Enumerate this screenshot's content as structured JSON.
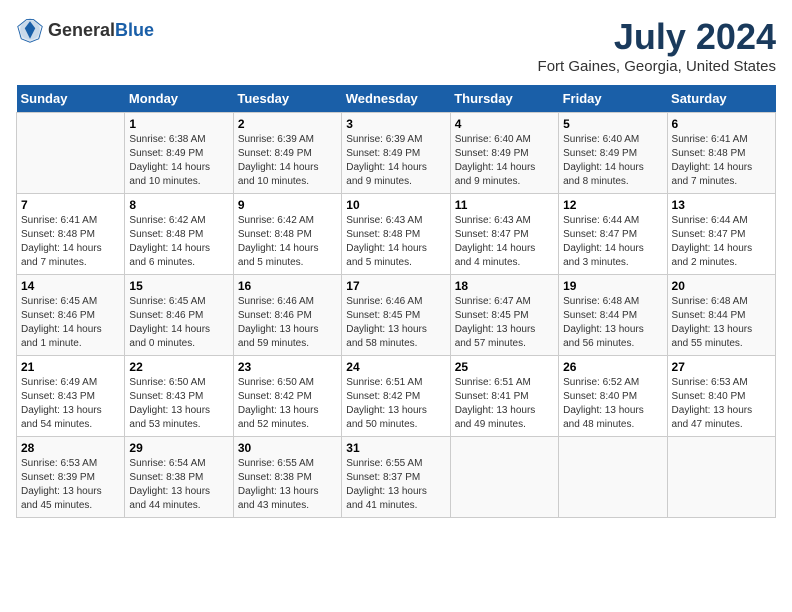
{
  "header": {
    "logo_general": "General",
    "logo_blue": "Blue",
    "title": "July 2024",
    "subtitle": "Fort Gaines, Georgia, United States"
  },
  "calendar": {
    "days_of_week": [
      "Sunday",
      "Monday",
      "Tuesday",
      "Wednesday",
      "Thursday",
      "Friday",
      "Saturday"
    ],
    "weeks": [
      [
        {
          "day": "",
          "info": ""
        },
        {
          "day": "1",
          "info": "Sunrise: 6:38 AM\nSunset: 8:49 PM\nDaylight: 14 hours\nand 10 minutes."
        },
        {
          "day": "2",
          "info": "Sunrise: 6:39 AM\nSunset: 8:49 PM\nDaylight: 14 hours\nand 10 minutes."
        },
        {
          "day": "3",
          "info": "Sunrise: 6:39 AM\nSunset: 8:49 PM\nDaylight: 14 hours\nand 9 minutes."
        },
        {
          "day": "4",
          "info": "Sunrise: 6:40 AM\nSunset: 8:49 PM\nDaylight: 14 hours\nand 9 minutes."
        },
        {
          "day": "5",
          "info": "Sunrise: 6:40 AM\nSunset: 8:49 PM\nDaylight: 14 hours\nand 8 minutes."
        },
        {
          "day": "6",
          "info": "Sunrise: 6:41 AM\nSunset: 8:48 PM\nDaylight: 14 hours\nand 7 minutes."
        }
      ],
      [
        {
          "day": "7",
          "info": "Sunrise: 6:41 AM\nSunset: 8:48 PM\nDaylight: 14 hours\nand 7 minutes."
        },
        {
          "day": "8",
          "info": "Sunrise: 6:42 AM\nSunset: 8:48 PM\nDaylight: 14 hours\nand 6 minutes."
        },
        {
          "day": "9",
          "info": "Sunrise: 6:42 AM\nSunset: 8:48 PM\nDaylight: 14 hours\nand 5 minutes."
        },
        {
          "day": "10",
          "info": "Sunrise: 6:43 AM\nSunset: 8:48 PM\nDaylight: 14 hours\nand 5 minutes."
        },
        {
          "day": "11",
          "info": "Sunrise: 6:43 AM\nSunset: 8:47 PM\nDaylight: 14 hours\nand 4 minutes."
        },
        {
          "day": "12",
          "info": "Sunrise: 6:44 AM\nSunset: 8:47 PM\nDaylight: 14 hours\nand 3 minutes."
        },
        {
          "day": "13",
          "info": "Sunrise: 6:44 AM\nSunset: 8:47 PM\nDaylight: 14 hours\nand 2 minutes."
        }
      ],
      [
        {
          "day": "14",
          "info": "Sunrise: 6:45 AM\nSunset: 8:46 PM\nDaylight: 14 hours\nand 1 minute."
        },
        {
          "day": "15",
          "info": "Sunrise: 6:45 AM\nSunset: 8:46 PM\nDaylight: 14 hours\nand 0 minutes."
        },
        {
          "day": "16",
          "info": "Sunrise: 6:46 AM\nSunset: 8:46 PM\nDaylight: 13 hours\nand 59 minutes."
        },
        {
          "day": "17",
          "info": "Sunrise: 6:46 AM\nSunset: 8:45 PM\nDaylight: 13 hours\nand 58 minutes."
        },
        {
          "day": "18",
          "info": "Sunrise: 6:47 AM\nSunset: 8:45 PM\nDaylight: 13 hours\nand 57 minutes."
        },
        {
          "day": "19",
          "info": "Sunrise: 6:48 AM\nSunset: 8:44 PM\nDaylight: 13 hours\nand 56 minutes."
        },
        {
          "day": "20",
          "info": "Sunrise: 6:48 AM\nSunset: 8:44 PM\nDaylight: 13 hours\nand 55 minutes."
        }
      ],
      [
        {
          "day": "21",
          "info": "Sunrise: 6:49 AM\nSunset: 8:43 PM\nDaylight: 13 hours\nand 54 minutes."
        },
        {
          "day": "22",
          "info": "Sunrise: 6:50 AM\nSunset: 8:43 PM\nDaylight: 13 hours\nand 53 minutes."
        },
        {
          "day": "23",
          "info": "Sunrise: 6:50 AM\nSunset: 8:42 PM\nDaylight: 13 hours\nand 52 minutes."
        },
        {
          "day": "24",
          "info": "Sunrise: 6:51 AM\nSunset: 8:42 PM\nDaylight: 13 hours\nand 50 minutes."
        },
        {
          "day": "25",
          "info": "Sunrise: 6:51 AM\nSunset: 8:41 PM\nDaylight: 13 hours\nand 49 minutes."
        },
        {
          "day": "26",
          "info": "Sunrise: 6:52 AM\nSunset: 8:40 PM\nDaylight: 13 hours\nand 48 minutes."
        },
        {
          "day": "27",
          "info": "Sunrise: 6:53 AM\nSunset: 8:40 PM\nDaylight: 13 hours\nand 47 minutes."
        }
      ],
      [
        {
          "day": "28",
          "info": "Sunrise: 6:53 AM\nSunset: 8:39 PM\nDaylight: 13 hours\nand 45 minutes."
        },
        {
          "day": "29",
          "info": "Sunrise: 6:54 AM\nSunset: 8:38 PM\nDaylight: 13 hours\nand 44 minutes."
        },
        {
          "day": "30",
          "info": "Sunrise: 6:55 AM\nSunset: 8:38 PM\nDaylight: 13 hours\nand 43 minutes."
        },
        {
          "day": "31",
          "info": "Sunrise: 6:55 AM\nSunset: 8:37 PM\nDaylight: 13 hours\nand 41 minutes."
        },
        {
          "day": "",
          "info": ""
        },
        {
          "day": "",
          "info": ""
        },
        {
          "day": "",
          "info": ""
        }
      ]
    ]
  }
}
